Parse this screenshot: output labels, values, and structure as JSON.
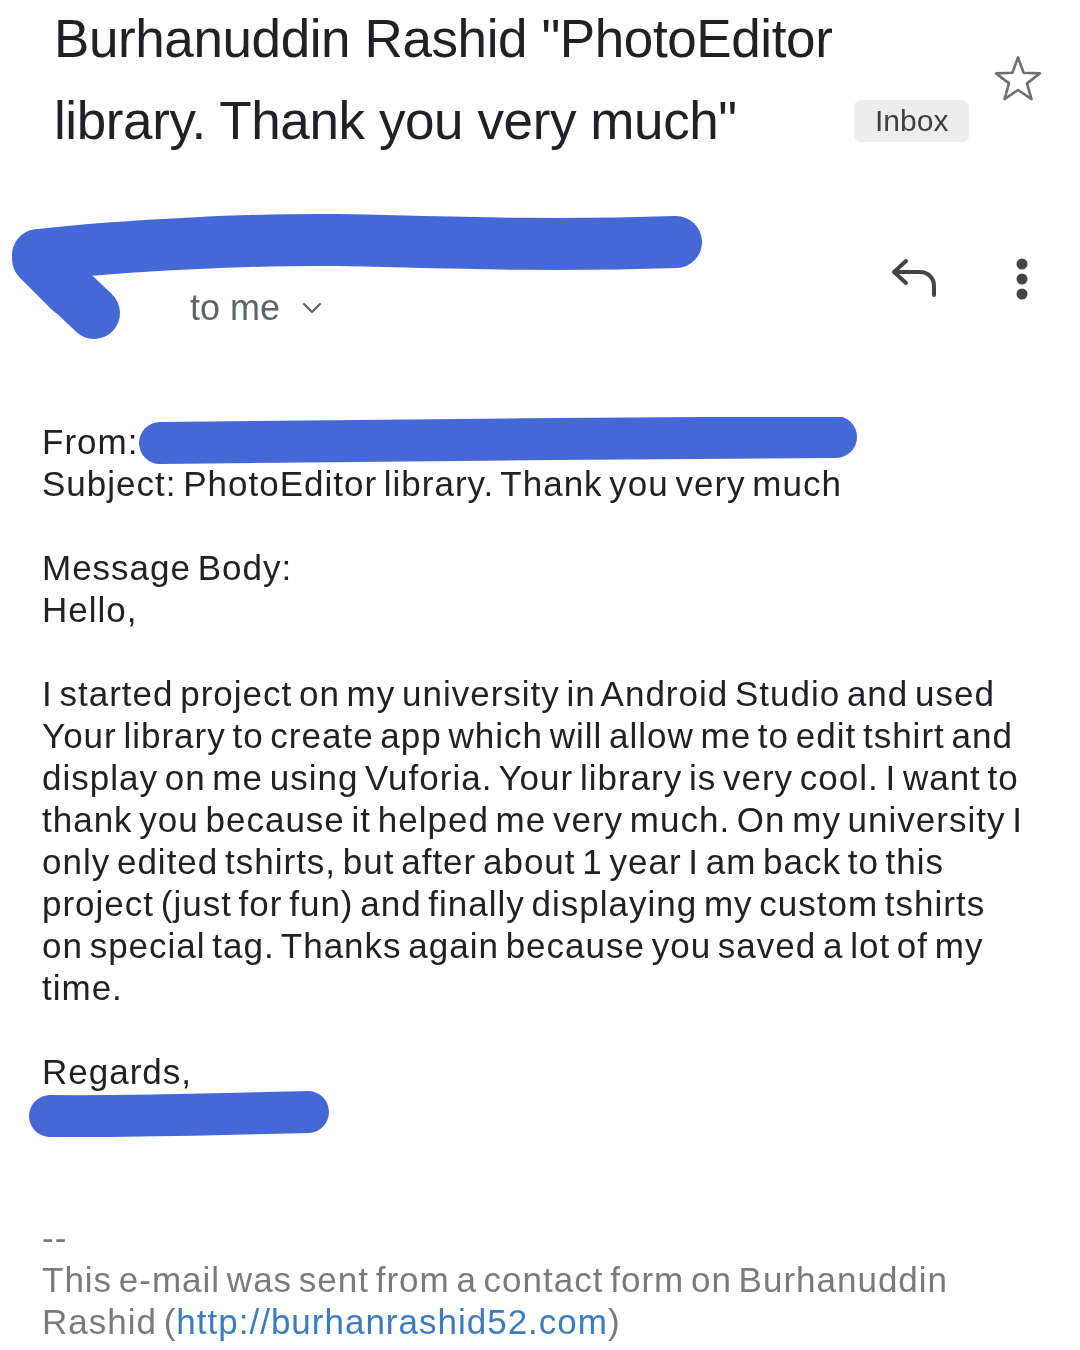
{
  "header": {
    "subject": "Burhanuddin Rashid \"PhotoEditor library. Thank you very much\"",
    "label": "Inbox",
    "starred": false
  },
  "sender": {
    "name_redacted": true,
    "recipient": "to me"
  },
  "body": {
    "from": {
      "label": "From:",
      "value_redacted": true
    },
    "subject_line": "Subject: PhotoEditor library. Thank you very much",
    "heading": "Message Body:",
    "greeting": "Hello,",
    "paragraph": "I started project on my university in Android Studio and used Your library to create app which will allow me to edit tshirt and display on me using Vuforia. Your library is very cool. I want to thank you because it helped me very much. On my university I only edited tshirts, but after about 1 year I am back to this project (just for fun) and finally displaying my custom tshirts on special tag. Thanks again because you saved a lot of my time.",
    "closing": "Regards,",
    "signature_redacted": true
  },
  "footer": {
    "separator": "--",
    "text": "This e-mail was sent from a contact form on Burhanuddin Rashid (",
    "link": "http://burhanrashid52.com",
    "text_end": ")"
  }
}
